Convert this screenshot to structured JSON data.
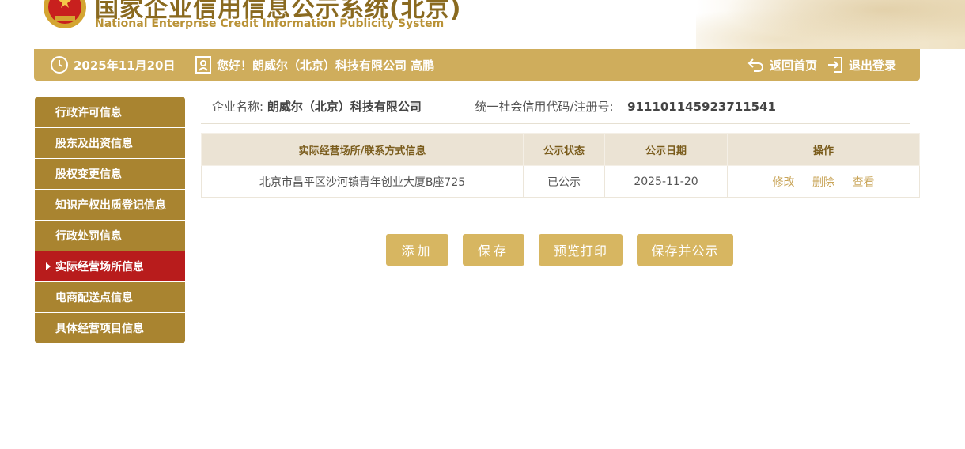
{
  "header": {
    "title_cn": "国家企业信用信息公示系统(北京)",
    "title_en": "National Enterprise Credit Information Publicity System"
  },
  "topbar": {
    "date": "2025年11月20日",
    "greeting": "您好！朗威尔（北京）科技有限公司 高鹏",
    "home_label": "返回首页",
    "logout_label": "退出登录"
  },
  "sidebar": {
    "items": [
      {
        "label": "行政许可信息",
        "active": false
      },
      {
        "label": "股东及出资信息",
        "active": false
      },
      {
        "label": "股权变更信息",
        "active": false
      },
      {
        "label": "知识产权出质登记信息",
        "active": false
      },
      {
        "label": "行政处罚信息",
        "active": false
      },
      {
        "label": "实际经营场所信息",
        "active": true
      },
      {
        "label": "电商配送点信息",
        "active": false
      },
      {
        "label": "具体经营项目信息",
        "active": false
      }
    ]
  },
  "company": {
    "name_label": "企业名称:",
    "name_value": "朗威尔（北京）科技有限公司",
    "code_label": "统一社会信用代码/注册号:",
    "code_value": "911101145923711541"
  },
  "table": {
    "headers": [
      "实际经营场所/联系方式信息",
      "公示状态",
      "公示日期",
      "操作"
    ],
    "rows": [
      {
        "address": "北京市昌平区沙河镇青年创业大厦B座725",
        "status": "已公示",
        "date": "2025-11-20",
        "actions": [
          "修改",
          "删除",
          "查看"
        ]
      }
    ]
  },
  "buttons": {
    "add": "添加",
    "save": "保存",
    "preview": "预览打印",
    "save_publish": "保存并公示"
  },
  "colors": {
    "gold_bar": "#cfad5c",
    "sidebar_bg": "#a98430",
    "sidebar_active": "#b81c1c",
    "button_bg": "#d7b661",
    "link": "#c9a559"
  }
}
